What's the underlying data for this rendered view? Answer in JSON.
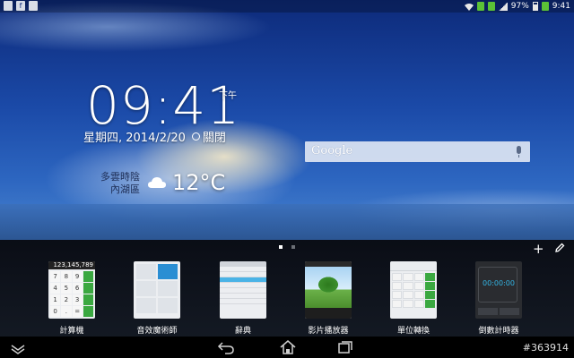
{
  "status_bar": {
    "battery": "97%",
    "time": "9:41"
  },
  "clock_widget": {
    "time": "09:41",
    "ampm": "下午",
    "date": "星期四, 2014/2/20",
    "alarm": "關閉",
    "weather_desc_line1": "多雲時陰",
    "weather_desc_line2": "內湖區",
    "temperature": "12°C"
  },
  "search": {
    "label": "Google"
  },
  "drawer": {
    "items": [
      {
        "label": "計算機",
        "display": "123,145,789"
      },
      {
        "label": "音效魔術師"
      },
      {
        "label": "辭典"
      },
      {
        "label": "影片播放器"
      },
      {
        "label": "單位轉換"
      },
      {
        "label": "倒數計時器",
        "display": "00:00:00"
      }
    ],
    "plus_icon": "plus-icon",
    "edit_icon": "pencil-icon"
  },
  "calculator_keys": [
    "7",
    "8",
    "9",
    "",
    "4",
    "5",
    "6",
    "",
    "1",
    "2",
    "3",
    "",
    "0",
    ".",
    "=",
    ""
  ],
  "watermark": "#363914",
  "colors": {
    "accent_green": "#3aa840",
    "accent_blue": "#33b5e5"
  }
}
